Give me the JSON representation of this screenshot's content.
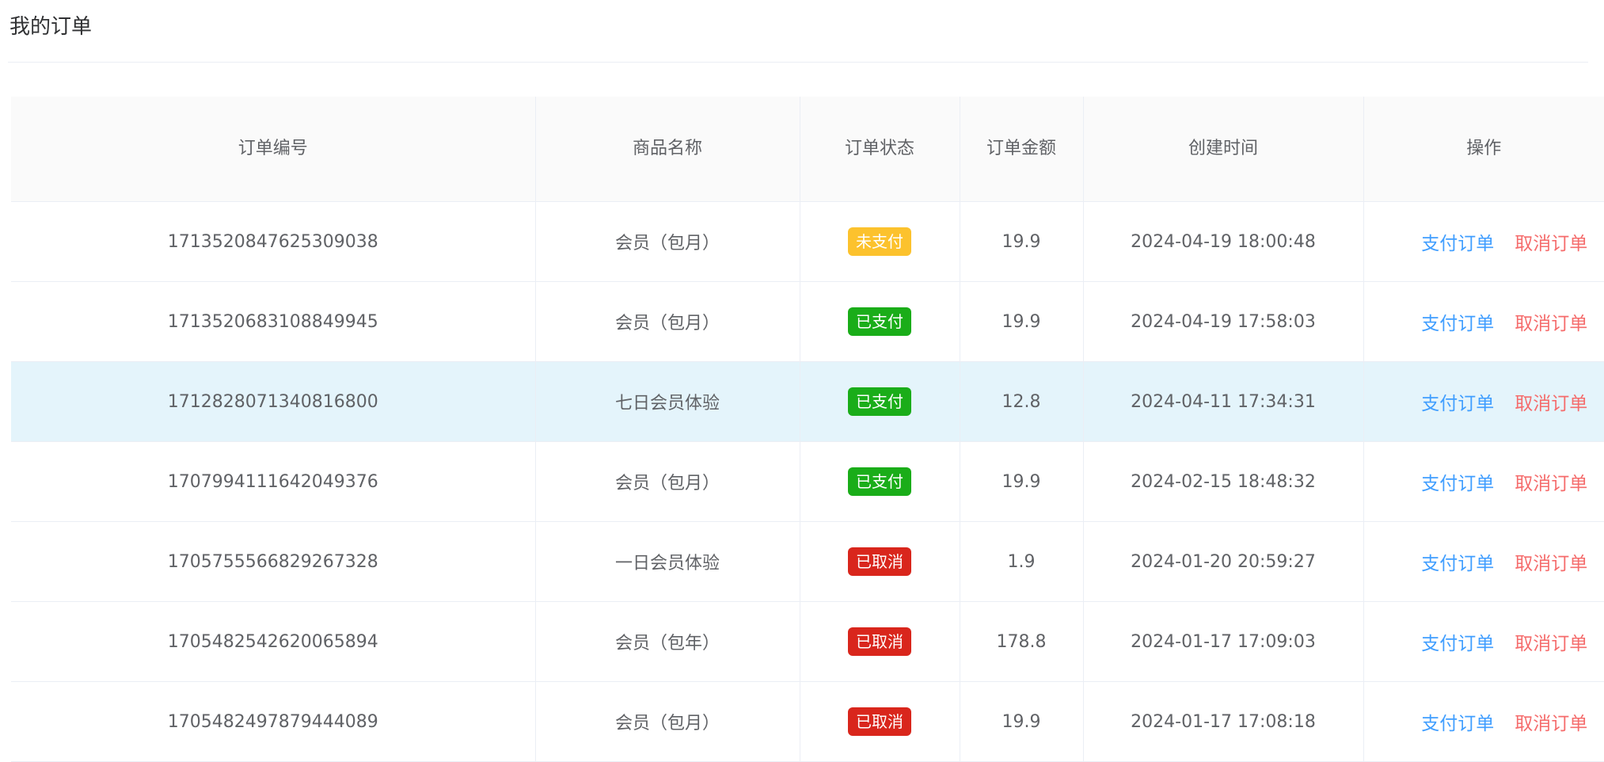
{
  "page": {
    "title": "我的订单"
  },
  "table": {
    "columns": [
      "订单编号",
      "商品名称",
      "订单状态",
      "订单金额",
      "创建时间",
      "操作"
    ],
    "rows": [
      {
        "order_no": "1713520847625309038",
        "product": "会员（包月）",
        "status": "未支付",
        "status_color": "#fcc22d",
        "amount": "19.9",
        "created": "2024-04-19 18:00:48",
        "pay_label": "支付订单",
        "cancel_label": "取消订单"
      },
      {
        "order_no": "1713520683108849945",
        "product": "会员（包月）",
        "status": "已支付",
        "status_color": "#1aad19",
        "amount": "19.9",
        "created": "2024-04-19 17:58:03",
        "pay_label": "支付订单",
        "cancel_label": "取消订单"
      },
      {
        "order_no": "1712828071340816800",
        "product": "七日会员体验",
        "status": "已支付",
        "status_color": "#1aad19",
        "amount": "12.8",
        "created": "2024-04-11 17:34:31",
        "pay_label": "支付订单",
        "cancel_label": "取消订单"
      },
      {
        "order_no": "1707994111642049376",
        "product": "会员（包月）",
        "status": "已支付",
        "status_color": "#1aad19",
        "amount": "19.9",
        "created": "2024-02-15 18:48:32",
        "pay_label": "支付订单",
        "cancel_label": "取消订单"
      },
      {
        "order_no": "1705755566829267328",
        "product": "一日会员体验",
        "status": "已取消",
        "status_color": "#d9261c",
        "amount": "1.9",
        "created": "2024-01-20 20:59:27",
        "pay_label": "支付订单",
        "cancel_label": "取消订单"
      },
      {
        "order_no": "1705482542620065894",
        "product": "会员（包年）",
        "status": "已取消",
        "status_color": "#d9261c",
        "amount": "178.8",
        "created": "2024-01-17 17:09:03",
        "pay_label": "支付订单",
        "cancel_label": "取消订单"
      },
      {
        "order_no": "1705482497879444089",
        "product": "会员（包月）",
        "status": "已取消",
        "status_color": "#d9261c",
        "amount": "19.9",
        "created": "2024-01-17 17:08:18",
        "pay_label": "支付订单",
        "cancel_label": "取消订单"
      }
    ]
  },
  "colors": {
    "link_blue": "#409eff",
    "link_red": "#f56c6c",
    "row_highlight": "#e4f4fb",
    "header_bg": "#fafafa"
  }
}
